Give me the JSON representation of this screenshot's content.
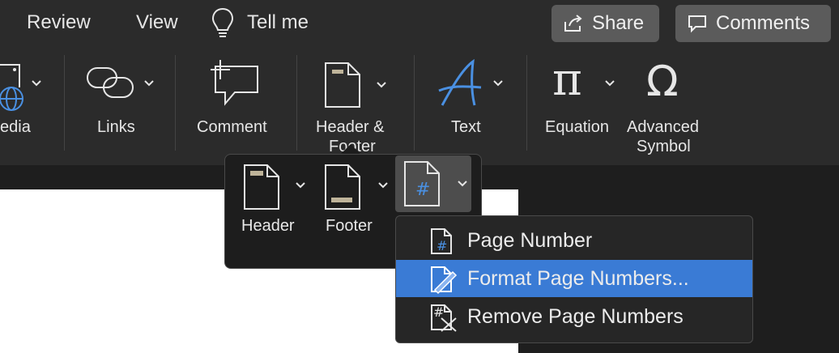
{
  "tabs": [
    "Review",
    "View"
  ],
  "tell_me": "Tell me",
  "share_label": "Share",
  "comments_label": "Comments",
  "ribbon": {
    "media_label": "edia",
    "links_label": "Links",
    "comment_label": "Comment",
    "header_footer_label_1": "Header &",
    "header_footer_label_2": "Footer",
    "text_label": "Text",
    "equation_label": "Equation",
    "advanced_symbol_label_1": "Advanced",
    "advanced_symbol_label_2": "Symbol",
    "equation_glyph": "π",
    "symbol_glyph": "Ω"
  },
  "header_footer_popover": {
    "header_label": "Header",
    "footer_label": "Footer",
    "page_number_glyph": "#"
  },
  "page_number_menu": {
    "items": [
      {
        "label": "Page Number",
        "glyph": "#"
      },
      {
        "label": "Format Page Numbers...",
        "glyph": ""
      },
      {
        "label": "Remove Page Numbers",
        "glyph": "#"
      }
    ],
    "active_index": 1
  },
  "colors": {
    "accent": "#3a7bd5",
    "icon_blue": "#4a90e2",
    "bg": "#2b2b2b"
  }
}
